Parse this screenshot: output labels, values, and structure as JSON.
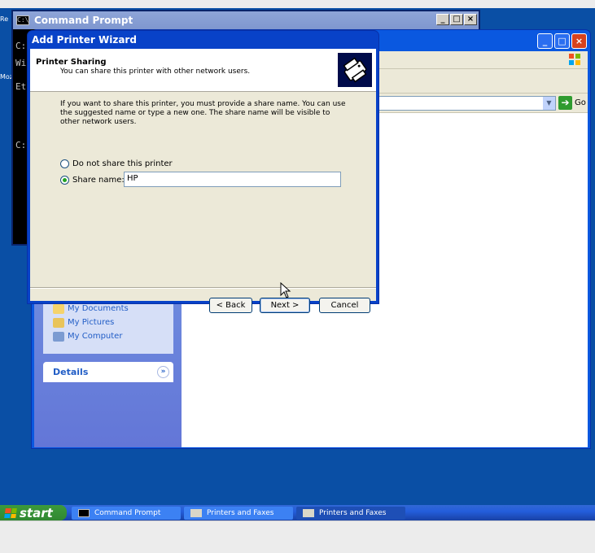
{
  "edge_labels": {
    "re": "Re",
    "moz": "Moz"
  },
  "cmd": {
    "title": "Command Prompt",
    "lines": [
      "C:",
      "Wi",
      "Et",
      "C:"
    ],
    "ctrl_min": "_",
    "ctrl_max": "□",
    "ctrl_close": "×"
  },
  "explorer": {
    "go_label": "Go",
    "ctrl_min": "_",
    "ctrl_max": "□",
    "ctrl_close": "×",
    "tasks": [
      "My Documents",
      "My Pictures",
      "My Computer"
    ],
    "details_label": "Details",
    "details_chevron": "»"
  },
  "wizard": {
    "title": "Add Printer Wizard",
    "header_title": "Printer Sharing",
    "header_subtitle": "You can share this printer with other network users.",
    "intro": "If you want to share this printer, you must provide a share name. You can use the suggested name or type a new one. The share name will be visible to other network users.",
    "option_no_share": "Do not share this printer",
    "option_share": "Share name:",
    "share_name": "HP",
    "selected_option": "share",
    "back_label": "< Back",
    "next_label": "Next >",
    "cancel_label": "Cancel"
  },
  "taskbar": {
    "start_label": "start",
    "items": [
      {
        "label": "Command Prompt",
        "active": false
      },
      {
        "label": "Printers and Faxes",
        "active": false
      },
      {
        "label": "Printers and Faxes",
        "active": true
      }
    ]
  },
  "colors": {
    "desktop": "#0a4fa5",
    "titlebar_blue": "#0842c8",
    "dialog_face": "#ece9d8",
    "start_green": "#308830"
  }
}
